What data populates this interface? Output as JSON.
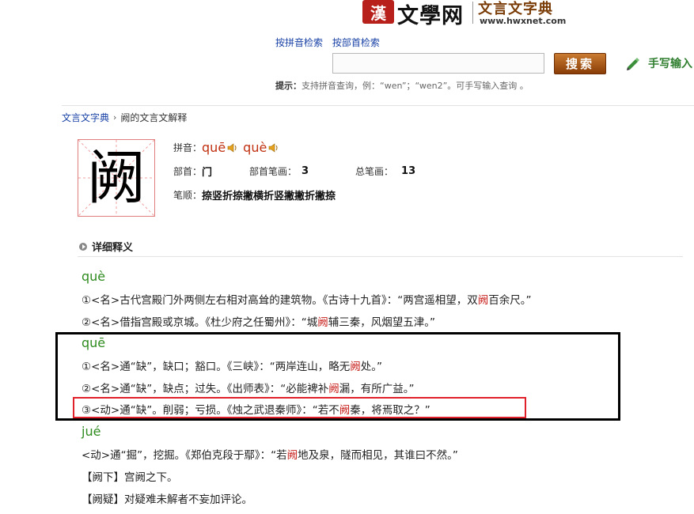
{
  "header": {
    "logo_seal": "漢",
    "logo_text": "文學网",
    "site_name": "文言文字典",
    "site_url": "www.hwxnet.com"
  },
  "search": {
    "link_pinyin": "按拼音检索",
    "link_radical": "按部首检索",
    "input_value": "",
    "button_label": "搜索",
    "handwrite_label": "手写输入",
    "hint_label": "提示：",
    "hint_text": "支持拼音查询，例：“wen”；“wen2”。可手写输入查询 。"
  },
  "breadcrumb": {
    "home": "文言文字典",
    "separator": "›",
    "current": "阙的文言文解释"
  },
  "character": {
    "glyph": "阙",
    "pinyin_label": "拼音：",
    "pinyin_1": "quē",
    "pinyin_2": "què",
    "radical_label": "部首：",
    "radical": "门",
    "radical_strokes_label": "部首笔画：",
    "radical_strokes": "3",
    "total_strokes_label": "总笔画：",
    "total_strokes": "13",
    "stroke_order_label": "笔顺：",
    "stroke_order": "捺竖折捺撇横折竖撇撇折撇捺"
  },
  "section": {
    "title": "详细释义"
  },
  "definitions": {
    "que4": {
      "pinyin": "què",
      "d1": {
        "a": "①<名>古代宫殿门外两侧左右相对高耸的建筑物。《古诗十九首》：“两宫遥相望，双",
        "hl": "阙",
        "b": "百余尺。”"
      },
      "d2": {
        "a": "②<名>借指宫殿或京城。《杜少府之任蜀州》：“城",
        "hl": "阙",
        "b": "辅三秦，风烟望五津。”"
      }
    },
    "que1": {
      "pinyin": "quē",
      "d1": {
        "a": "①<名>通“缺”，缺口；豁口。《三峡》：“两岸连山，略无",
        "hl": "阙",
        "b": "处。”"
      },
      "d2": {
        "a": "②<名>通“缺”，缺点；过失。《出师表》：“必能裨补",
        "hl": "阙",
        "b": "漏，有所广益。”"
      },
      "d3": {
        "a": "③<动>通“缺”。削弱；亏损。《烛之武退秦师》：“若不",
        "hl": "阙",
        "b": "秦，将焉取之？”"
      }
    },
    "jue2": {
      "pinyin": "jué",
      "d1": {
        "a": "<动>通“掘”，挖掘。《郑伯克段于鄢》：“若",
        "hl": "阙",
        "b": "地及泉，隧而相见，其谁曰不然。”"
      }
    },
    "phrases": {
      "p1": "【阙下】宫阙之下。",
      "p2": "【阙疑】对疑难未解者不妄加评论。"
    }
  },
  "colors": {
    "brand_brown": "#7a3d08",
    "link_blue": "#1a43a6",
    "pinyin_green": "#2e8b1e",
    "highlight_red": "#c8201c",
    "annotation_red": "#e0212a",
    "annotation_black": "#000000"
  }
}
